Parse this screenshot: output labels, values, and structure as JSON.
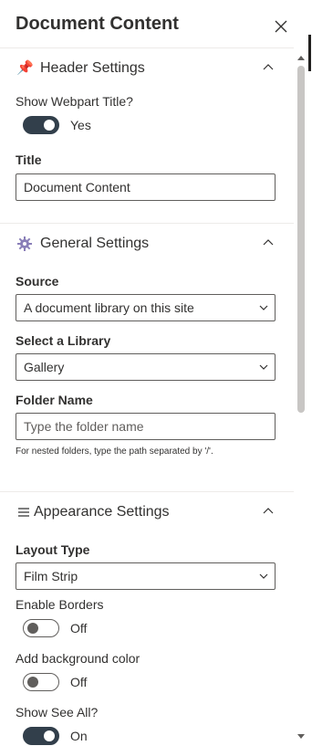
{
  "panel": {
    "title": "Document Content",
    "close_icon": "close-icon"
  },
  "header_settings": {
    "icon": "pushpin-icon",
    "title": "Header Settings",
    "show_title_label": "Show Webpart Title?",
    "show_title_state": "Yes",
    "title_label": "Title",
    "title_value": "Document Content"
  },
  "general_settings": {
    "icon": "gear-icon",
    "title": "General Settings",
    "source_label": "Source",
    "source_value": "A document library on this site",
    "library_label": "Select a Library",
    "library_value": "Gallery",
    "folder_label": "Folder Name",
    "folder_placeholder": "Type the folder name",
    "folder_hint": "For nested folders, type the path separated by '/'."
  },
  "appearance_settings": {
    "icon": "menu-lines-icon",
    "title": "Appearance Settings",
    "layout_label": "Layout Type",
    "layout_value": "Film Strip",
    "borders_label": "Enable Borders",
    "borders_state": "Off",
    "bg_label": "Add background color",
    "bg_state": "Off",
    "see_all_label": "Show See All?",
    "see_all_state": "On"
  },
  "colors": {
    "toggle_on": "#323f4b",
    "text": "#323130",
    "border": "#605e5c",
    "divider": "#edebe9"
  }
}
